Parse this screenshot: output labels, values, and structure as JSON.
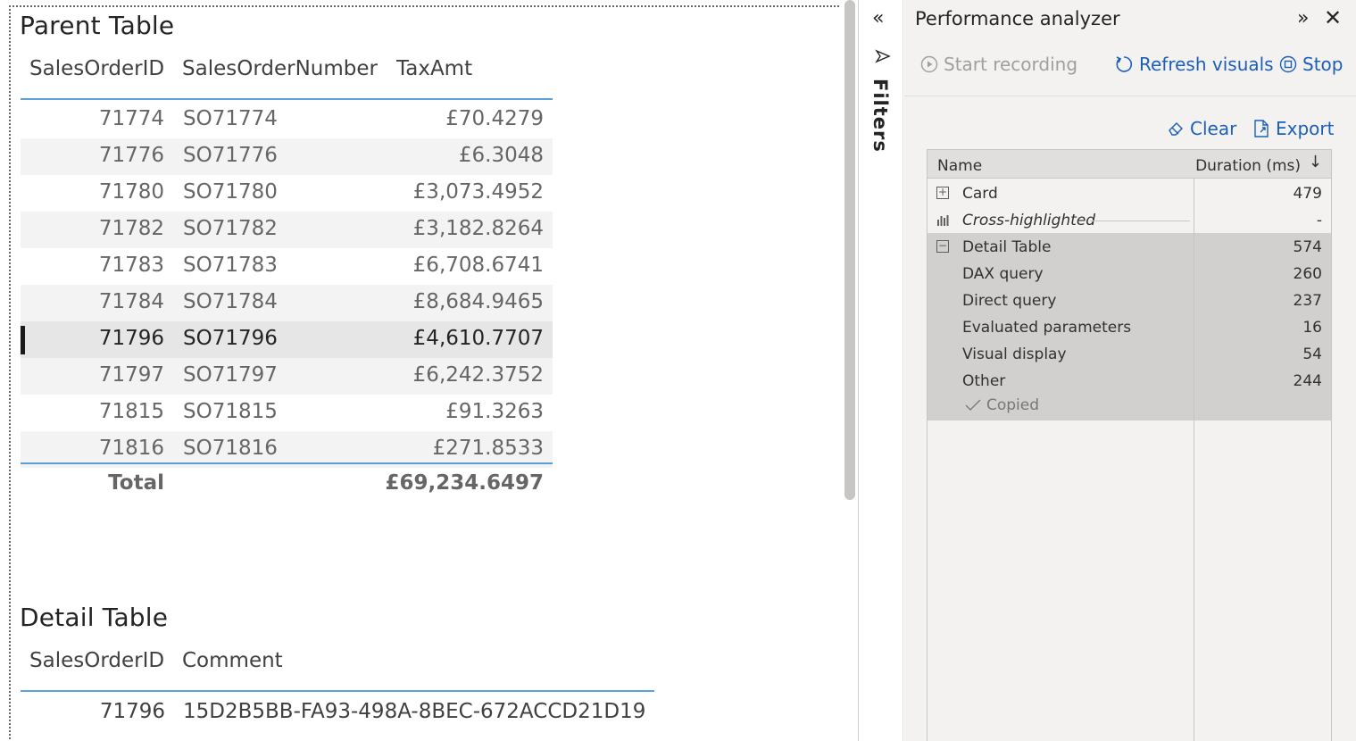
{
  "parent_table": {
    "title": "Parent Table",
    "columns": [
      "SalesOrderID",
      "SalesOrderNumber",
      "TaxAmt"
    ],
    "rows": [
      {
        "id": "71774",
        "number": "SO71774",
        "tax": "£70.4279"
      },
      {
        "id": "71776",
        "number": "SO71776",
        "tax": "£6.3048"
      },
      {
        "id": "71780",
        "number": "SO71780",
        "tax": "£3,073.4952"
      },
      {
        "id": "71782",
        "number": "SO71782",
        "tax": "£3,182.8264"
      },
      {
        "id": "71783",
        "number": "SO71783",
        "tax": "£6,708.6741"
      },
      {
        "id": "71784",
        "number": "SO71784",
        "tax": "£8,684.9465"
      },
      {
        "id": "71796",
        "number": "SO71796",
        "tax": "£4,610.7707"
      },
      {
        "id": "71797",
        "number": "SO71797",
        "tax": "£6,242.3752"
      },
      {
        "id": "71815",
        "number": "SO71815",
        "tax": "£91.3263"
      },
      {
        "id": "71816",
        "number": "SO71816",
        "tax": "£271.8533"
      }
    ],
    "selected_row": "71796",
    "total_label": "Total",
    "total_value": "£69,234.6497"
  },
  "detail_table": {
    "title": "Detail Table",
    "columns": [
      "SalesOrderID",
      "Comment"
    ],
    "rows": [
      {
        "id": "71796",
        "comment": "15D2B5BB-FA93-498A-8BEC-672ACCD21D19"
      }
    ]
  },
  "filters_pane": {
    "label": "Filters",
    "collapse_icon": "double-chevron-left-icon",
    "filter_icon": "filter-funnel-icon"
  },
  "performance_analyzer": {
    "title": "Performance analyzer",
    "start_recording": "Start recording",
    "refresh_visuals": "Refresh visuals",
    "stop": "Stop",
    "clear": "Clear",
    "export": "Export",
    "grid_header": {
      "name": "Name",
      "duration": "Duration (ms)"
    },
    "rows": [
      {
        "name": "Card",
        "value": "479",
        "icon": "expand-plus-icon"
      },
      {
        "name": "Cross-highlighted",
        "value": "-",
        "icon": "bar-chart-icon"
      },
      {
        "name": "Detail Table",
        "value": "574",
        "icon": "collapse-minus-icon"
      },
      {
        "name": "DAX query",
        "value": "260"
      },
      {
        "name": "Direct query",
        "value": "237"
      },
      {
        "name": "Evaluated parameters",
        "value": "16"
      },
      {
        "name": "Visual display",
        "value": "54"
      },
      {
        "name": "Other",
        "value": "244"
      }
    ],
    "copied": "Copied"
  },
  "colors": {
    "accent_blue": "#1b5fb8",
    "table_line": "#5aa0d8",
    "selected_row": "#e6e6e6",
    "pane_bg": "#f3f2f1"
  }
}
